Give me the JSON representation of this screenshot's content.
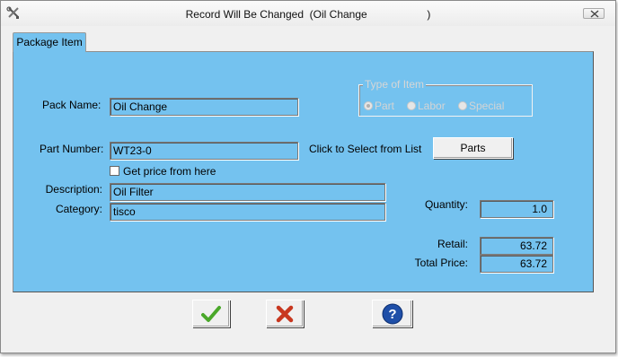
{
  "window": {
    "title": "Record Will Be Changed  (Oil Change                    )",
    "app_icon": "tools-icon",
    "close_icon": "close-icon"
  },
  "tabs": [
    {
      "label": "Package Item",
      "active": true
    }
  ],
  "form": {
    "pack_name_label": "Pack Name:",
    "pack_name_value": "Oil Change",
    "part_number_label": "Part Number:",
    "part_number_value": "WT23-0",
    "select_hint": "Click to Select from List",
    "parts_button": "Parts",
    "get_price_label": "Get price from here",
    "get_price_checked": false,
    "description_label": "Description:",
    "description_value": "Oil Filter",
    "category_label": "Category:",
    "category_value": "tisco",
    "quantity_label": "Quantity:",
    "quantity_value": "1.0",
    "retail_label": "Retail:",
    "retail_value": "63.72",
    "total_price_label": "Total Price:",
    "total_price_value": "63.72"
  },
  "type_of_item": {
    "title": "Type of Item",
    "options": [
      "Part",
      "Labor",
      "Special"
    ],
    "selected": "Part",
    "disabled": true
  },
  "buttons": {
    "ok_icon": "checkmark-icon",
    "cancel_icon": "x-icon",
    "help_icon": "help-icon"
  },
  "colors": {
    "panel": "#74c2ef",
    "ok": "#4aa82a",
    "cancel": "#c8371f",
    "help": "#1f4fa8"
  }
}
